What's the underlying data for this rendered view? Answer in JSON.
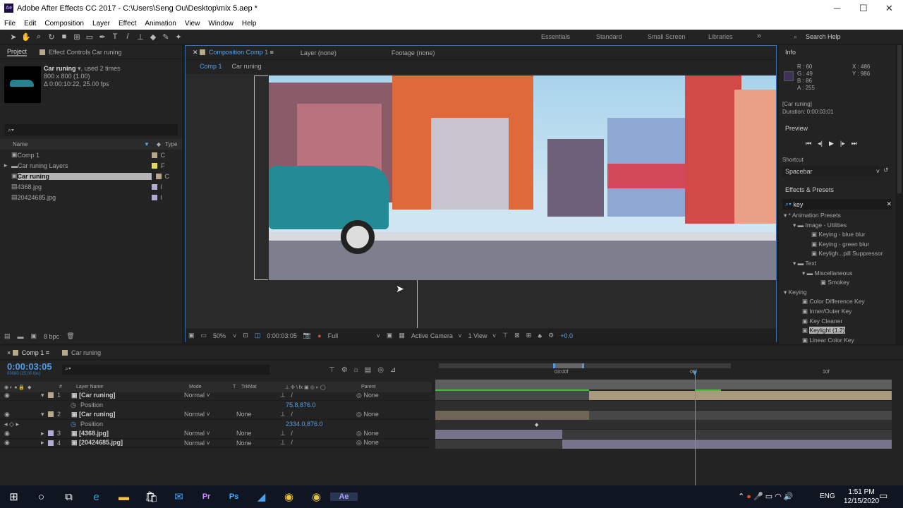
{
  "window": {
    "title": "Adobe After Effects CC 2017 - C:\\Users\\Seng Ou\\Desktop\\mix 5.aep *",
    "app_icon": "Ae"
  },
  "menu": [
    "File",
    "Edit",
    "Composition",
    "Layer",
    "Effect",
    "Animation",
    "View",
    "Window",
    "Help"
  ],
  "workspaces": [
    "Essentials",
    "Standard",
    "Small Screen",
    "Libraries"
  ],
  "search_help": "Search Help",
  "project": {
    "tab": "Project",
    "effect_controls_tab": "Effect Controls Car runing",
    "selected_name": "Car runing",
    "used": ", used 2 times",
    "dims": "800 x 800 (1.00)",
    "duration": "Δ 0:00:10:22, 25.00 fps",
    "search_placeholder": "",
    "col_name": "Name",
    "col_type": "Type",
    "bpc": "8 bpc",
    "items": [
      {
        "name": "Comp 1",
        "type": "C",
        "color": "#b5a88a"
      },
      {
        "name": "Car runing Layers",
        "type": "F",
        "color": "#e3dc52"
      },
      {
        "name": "Car runing",
        "type": "C",
        "color": "#b5a88a"
      },
      {
        "name": "4368.jpg",
        "type": "I",
        "color": "#b3acd2"
      },
      {
        "name": "20424685.jpg",
        "type": "I",
        "color": "#b3acd2"
      }
    ]
  },
  "comp": {
    "tab": "Composition Comp 1",
    "layer_tab": "Layer (none)",
    "footage_tab": "Footage (none)",
    "breadcrumb": [
      "Comp 1",
      "Car runing"
    ],
    "zoom": "50%",
    "time": "0:00:03:05",
    "resolution": "Full",
    "camera": "Active Camera",
    "view": "1 View",
    "exposure": "+0.0"
  },
  "info": {
    "title": "Info",
    "r": "R : 60",
    "g": "G : 49",
    "b": "B : 86",
    "a": "A : 255",
    "x": "X : 486",
    "y": "Y : 986",
    "layer": "[Car runing]",
    "duration": "Duration: 0:00:03:01",
    "swatch": "#3c3156"
  },
  "preview": {
    "title": "Preview",
    "shortcut_label": "Shortcut",
    "shortcut": "Spacebar"
  },
  "effects": {
    "title": "Effects & Presets",
    "search": "key",
    "tree": [
      {
        "label": "* Animation Presets",
        "indent": 0,
        "kind": "tri"
      },
      {
        "label": "Image - Utilities",
        "indent": 1,
        "kind": "folder"
      },
      {
        "label": "Keying - blue blur",
        "indent": 3,
        "kind": "item"
      },
      {
        "label": "Keying - green blur",
        "indent": 3,
        "kind": "item"
      },
      {
        "label": "Keyligh...pill Suppressor",
        "indent": 3,
        "kind": "item"
      },
      {
        "label": "Text",
        "indent": 1,
        "kind": "folder"
      },
      {
        "label": "Miscellaneous",
        "indent": 2,
        "kind": "folder"
      },
      {
        "label": "Smokey",
        "indent": 4,
        "kind": "item"
      },
      {
        "label": "Keying",
        "indent": 0,
        "kind": "tri"
      },
      {
        "label": "Color Difference Key",
        "indent": 2,
        "kind": "item"
      },
      {
        "label": "Inner/Outer Key",
        "indent": 2,
        "kind": "item"
      },
      {
        "label": "Key Cleaner",
        "indent": 2,
        "kind": "item"
      },
      {
        "label": "Keylight (1.2)",
        "indent": 2,
        "kind": "item",
        "selected": true
      },
      {
        "label": "Linear Color Key",
        "indent": 2,
        "kind": "item"
      }
    ]
  },
  "timeline": {
    "tab": "Comp 1",
    "tab2": "Car runing",
    "time": "0:00:03:05",
    "frames": "00080 (25.00 fps)",
    "cols": {
      "name": "Layer Name",
      "mode": "Mode",
      "t": "T",
      "trkmat": "TrkMat",
      "parent": "Parent",
      "num": "#"
    },
    "ruler": [
      "03:00f",
      "05f",
      "10f"
    ],
    "layers": [
      {
        "num": "1",
        "name": "[Car runing]",
        "mode": "Normal",
        "trkmat": "",
        "parent": "None",
        "color": "#b5a88a",
        "prop": "Position",
        "value": "75.8,876.0"
      },
      {
        "num": "2",
        "name": "[Car runing]",
        "mode": "Normal",
        "trkmat": "None",
        "parent": "None",
        "color": "#b5a88a",
        "prop": "Position",
        "value": "2334.0,876.0"
      },
      {
        "num": "3",
        "name": "[4368.jpg]",
        "mode": "Normal",
        "trkmat": "None",
        "parent": "None",
        "color": "#b3acd2"
      },
      {
        "num": "4",
        "name": "[20424685.jpg]",
        "mode": "Normal",
        "trkmat": "None",
        "parent": "None",
        "color": "#b3acd2"
      }
    ]
  },
  "taskbar": {
    "lang": "ENG",
    "time": "1:51 PM",
    "date": "12/15/2020"
  }
}
